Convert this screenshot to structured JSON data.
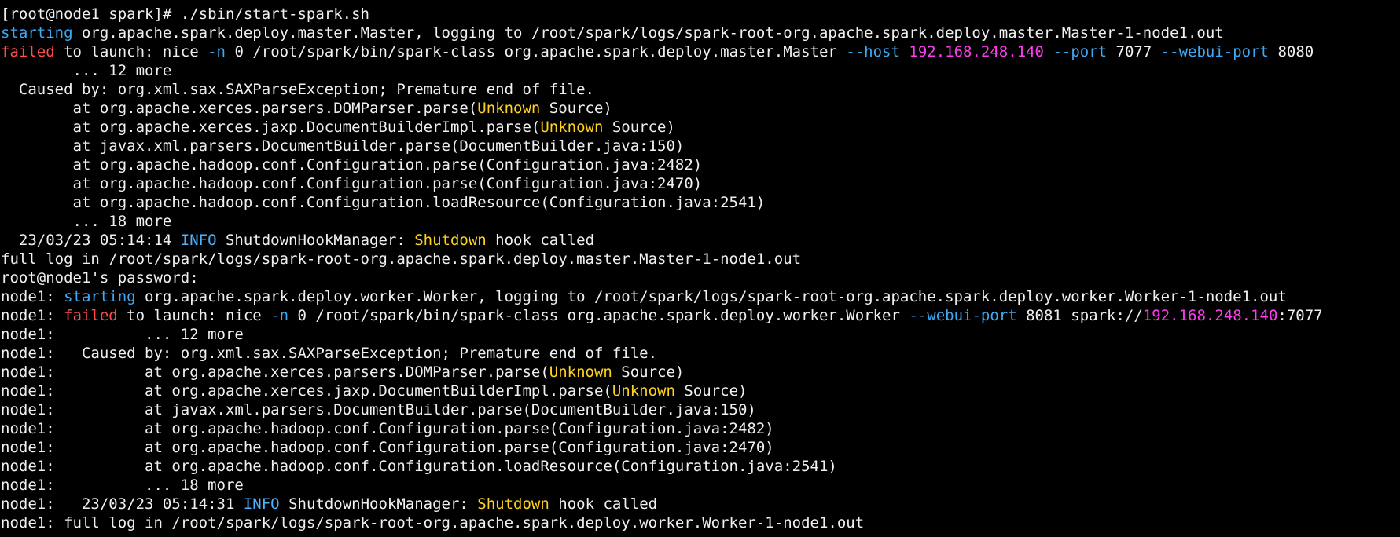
{
  "theme": {
    "background": "#000000",
    "foreground": "#f0f0f0",
    "cyan": "#3fa9f5",
    "red": "#ff4d4d",
    "magenta": "#ff3cf0",
    "yellow": "#ffd21e",
    "blue": "#4db3ff"
  },
  "lines": [
    [
      {
        "t": "[root@node1 spark]# ./sbin/start-spark.sh",
        "c": "fg"
      }
    ],
    [
      {
        "t": "starting",
        "c": "cyan"
      },
      {
        "t": " org.apache.spark.deploy.master.Master, logging to /root/spark/logs/spark-root-org.apache.spark.deploy.master.Master-1-node1.out",
        "c": "fg"
      }
    ],
    [
      {
        "t": "failed",
        "c": "red"
      },
      {
        "t": " to launch: nice ",
        "c": "fg"
      },
      {
        "t": "-n",
        "c": "cyan"
      },
      {
        "t": " 0 /root/spark/bin/spark-class org.apache.spark.deploy.master.Master ",
        "c": "fg"
      },
      {
        "t": "--host",
        "c": "cyan"
      },
      {
        "t": " ",
        "c": "fg"
      },
      {
        "t": "192.168.248.140",
        "c": "magenta"
      },
      {
        "t": " ",
        "c": "fg"
      },
      {
        "t": "--port",
        "c": "cyan"
      },
      {
        "t": " 7077 ",
        "c": "fg"
      },
      {
        "t": "--webui-port",
        "c": "cyan"
      },
      {
        "t": " 8080",
        "c": "fg"
      }
    ],
    [
      {
        "t": "        ... 12 more",
        "c": "fg"
      }
    ],
    [
      {
        "t": "  Caused by: org.xml.sax.SAXParseException; Premature end of file.",
        "c": "fg"
      }
    ],
    [
      {
        "t": "        at org.apache.xerces.parsers.DOMParser.parse(",
        "c": "fg"
      },
      {
        "t": "Unknown",
        "c": "yellow"
      },
      {
        "t": " Source)",
        "c": "fg"
      }
    ],
    [
      {
        "t": "        at org.apache.xerces.jaxp.DocumentBuilderImpl.parse(",
        "c": "fg"
      },
      {
        "t": "Unknown",
        "c": "yellow"
      },
      {
        "t": " Source)",
        "c": "fg"
      }
    ],
    [
      {
        "t": "        at javax.xml.parsers.DocumentBuilder.parse(DocumentBuilder.java:150)",
        "c": "fg"
      }
    ],
    [
      {
        "t": "        at org.apache.hadoop.conf.Configuration.parse(Configuration.java:2482)",
        "c": "fg"
      }
    ],
    [
      {
        "t": "        at org.apache.hadoop.conf.Configuration.parse(Configuration.java:2470)",
        "c": "fg"
      }
    ],
    [
      {
        "t": "        at org.apache.hadoop.conf.Configuration.loadResource(Configuration.java:2541)",
        "c": "fg"
      }
    ],
    [
      {
        "t": "        ... 18 more",
        "c": "fg"
      }
    ],
    [
      {
        "t": "  23/03/23 05:14:14 ",
        "c": "fg"
      },
      {
        "t": "INFO",
        "c": "blue"
      },
      {
        "t": " ShutdownHookManager: ",
        "c": "fg"
      },
      {
        "t": "Shutdown",
        "c": "yellow"
      },
      {
        "t": " hook called",
        "c": "fg"
      }
    ],
    [
      {
        "t": "full log in /root/spark/logs/spark-root-org.apache.spark.deploy.master.Master-1-node1.out",
        "c": "fg"
      }
    ],
    [
      {
        "t": "root@node1's password:",
        "c": "fg"
      }
    ],
    [
      {
        "t": "node1: ",
        "c": "fg"
      },
      {
        "t": "starting",
        "c": "cyan"
      },
      {
        "t": " org.apache.spark.deploy.worker.Worker, logging to /root/spark/logs/spark-root-org.apache.spark.deploy.worker.Worker-1-node1.out",
        "c": "fg"
      }
    ],
    [
      {
        "t": "node1: ",
        "c": "fg"
      },
      {
        "t": "failed",
        "c": "red"
      },
      {
        "t": " to launch: nice ",
        "c": "fg"
      },
      {
        "t": "-n",
        "c": "cyan"
      },
      {
        "t": " 0 /root/spark/bin/spark-class org.apache.spark.deploy.worker.Worker ",
        "c": "fg"
      },
      {
        "t": "--webui-port",
        "c": "cyan"
      },
      {
        "t": " 8081 spark://",
        "c": "fg"
      },
      {
        "t": "192.168.248.140",
        "c": "magenta"
      },
      {
        "t": ":7077",
        "c": "fg"
      }
    ],
    [
      {
        "t": "node1:          ... 12 more",
        "c": "fg"
      }
    ],
    [
      {
        "t": "node1:   Caused by: org.xml.sax.SAXParseException; Premature end of file.",
        "c": "fg"
      }
    ],
    [
      {
        "t": "node1:          at org.apache.xerces.parsers.DOMParser.parse(",
        "c": "fg"
      },
      {
        "t": "Unknown",
        "c": "yellow"
      },
      {
        "t": " Source)",
        "c": "fg"
      }
    ],
    [
      {
        "t": "node1:          at org.apache.xerces.jaxp.DocumentBuilderImpl.parse(",
        "c": "fg"
      },
      {
        "t": "Unknown",
        "c": "yellow"
      },
      {
        "t": " Source)",
        "c": "fg"
      }
    ],
    [
      {
        "t": "node1:          at javax.xml.parsers.DocumentBuilder.parse(DocumentBuilder.java:150)",
        "c": "fg"
      }
    ],
    [
      {
        "t": "node1:          at org.apache.hadoop.conf.Configuration.parse(Configuration.java:2482)",
        "c": "fg"
      }
    ],
    [
      {
        "t": "node1:          at org.apache.hadoop.conf.Configuration.parse(Configuration.java:2470)",
        "c": "fg"
      }
    ],
    [
      {
        "t": "node1:          at org.apache.hadoop.conf.Configuration.loadResource(Configuration.java:2541)",
        "c": "fg"
      }
    ],
    [
      {
        "t": "node1:          ... 18 more",
        "c": "fg"
      }
    ],
    [
      {
        "t": "node1:   23/03/23 05:14:31 ",
        "c": "fg"
      },
      {
        "t": "INFO",
        "c": "blue"
      },
      {
        "t": " ShutdownHookManager: ",
        "c": "fg"
      },
      {
        "t": "Shutdown",
        "c": "yellow"
      },
      {
        "t": " hook called",
        "c": "fg"
      }
    ],
    [
      {
        "t": "node1: full log in /root/spark/logs/spark-root-org.apache.spark.deploy.worker.Worker-1-node1.out",
        "c": "fg"
      }
    ]
  ]
}
